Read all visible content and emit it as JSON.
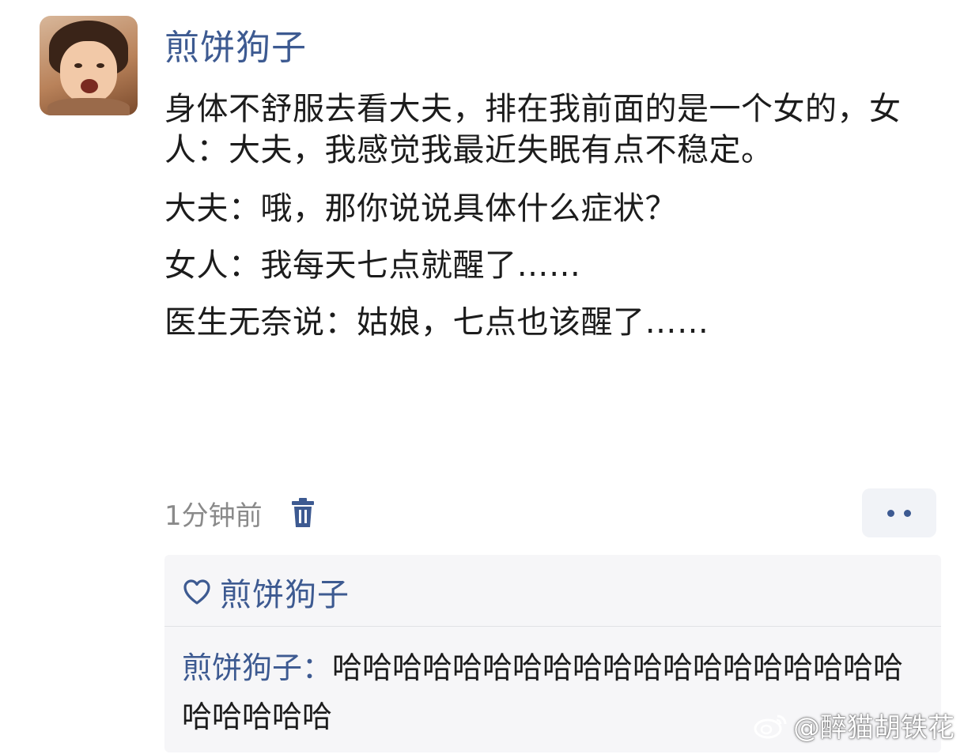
{
  "post": {
    "author": "煎饼狗子",
    "paragraphs": [
      "身体不舒服去看大夫，排在我前面的是一个女的，女人：大夫，我感觉我最近失眠有点不稳定。",
      "大夫：哦，那你说说具体什么症状？",
      "女人：我每天七点就醒了……",
      "医生无奈说：姑娘，七点也该醒了……"
    ],
    "timestamp": "1分钟前"
  },
  "reply_section": {
    "liker": "煎饼狗子",
    "reply_author": "煎饼狗子：",
    "reply_body": "哈哈哈哈哈哈哈哈哈哈哈哈哈哈哈哈哈哈哈哈哈哈哈哈"
  },
  "watermark": {
    "handle": "@醉猫胡铁花"
  },
  "icons": {
    "avatar": "user-avatar",
    "delete": "trash-icon",
    "more": "more-dots-icon",
    "like": "heart-icon",
    "brand": "weibo-icon"
  },
  "colors": {
    "username": "#3d5a91",
    "text": "#1c1c1c",
    "muted": "#8a8a8a",
    "reply_bg": "#f6f6f8"
  }
}
